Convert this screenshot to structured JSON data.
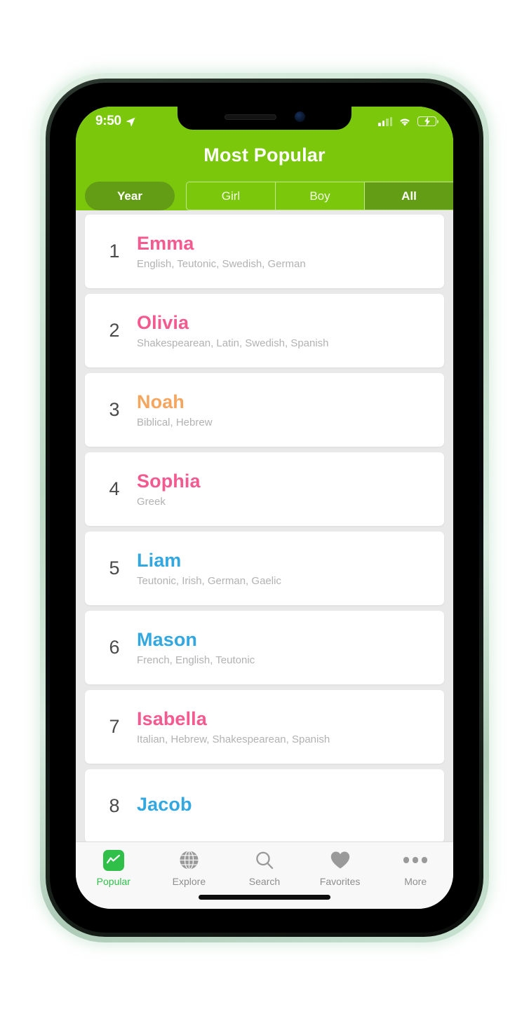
{
  "status_bar": {
    "time": "9:50",
    "location_icon": "location-arrow-icon",
    "signal_icon": "cellular-signal-icon",
    "signal_bars_filled": 2,
    "signal_bars_total": 4,
    "wifi_icon": "wifi-icon",
    "battery_icon": "battery-charging-icon"
  },
  "header": {
    "title": "Most Popular",
    "background_color": "#7ac70c"
  },
  "filters": {
    "period_button": "Year",
    "segments": [
      {
        "label": "Girl",
        "active": false
      },
      {
        "label": "Boy",
        "active": false
      },
      {
        "label": "All",
        "active": true
      }
    ],
    "active_segment_color": "#639d16"
  },
  "name_colors": {
    "girl": "#f4598f",
    "boy": "#33a7e0",
    "unisex": "#f4a55e"
  },
  "list": [
    {
      "rank": "1",
      "name": "Emma",
      "gender": "girl",
      "origins": "English, Teutonic, Swedish, German"
    },
    {
      "rank": "2",
      "name": "Olivia",
      "gender": "girl",
      "origins": "Shakespearean, Latin, Swedish, Spanish"
    },
    {
      "rank": "3",
      "name": "Noah",
      "gender": "unisex",
      "origins": "Biblical, Hebrew"
    },
    {
      "rank": "4",
      "name": "Sophia",
      "gender": "girl",
      "origins": "Greek"
    },
    {
      "rank": "5",
      "name": "Liam",
      "gender": "boy",
      "origins": "Teutonic, Irish, German, Gaelic"
    },
    {
      "rank": "6",
      "name": "Mason",
      "gender": "boy",
      "origins": "French, English, Teutonic"
    },
    {
      "rank": "7",
      "name": "Isabella",
      "gender": "girl",
      "origins": "Italian, Hebrew, Shakespearean, Spanish"
    },
    {
      "rank": "8",
      "name": "Jacob",
      "gender": "boy",
      "origins": ""
    }
  ],
  "tabbar": {
    "tabs": [
      {
        "label": "Popular",
        "icon": "line-chart-icon",
        "active": true
      },
      {
        "label": "Explore",
        "icon": "globe-icon",
        "active": false
      },
      {
        "label": "Search",
        "icon": "magnifier-icon",
        "active": false
      },
      {
        "label": "Favorites",
        "icon": "heart-icon",
        "active": false
      },
      {
        "label": "More",
        "icon": "ellipsis-icon",
        "active": false
      }
    ],
    "active_color": "#30c04a"
  }
}
